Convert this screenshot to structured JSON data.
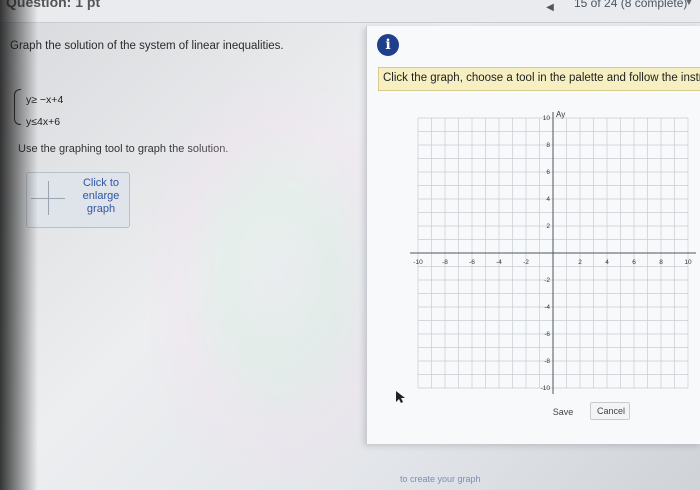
{
  "header": {
    "title": "Question: 1 pt",
    "progress": "15 of 24 (8 complete)",
    "prev_icon": "left-arrow-icon",
    "dropdown_icon": "chevron-down-icon"
  },
  "question": {
    "prompt": "Graph the solution of the system of linear inequalities.",
    "inequalities": [
      "y≥ −x+4",
      "y≤4x+6"
    ],
    "instruction": "Use the graphing tool to graph the solution.",
    "enlarge_label": "Click to enlarge graph"
  },
  "panel": {
    "info_icon": "i",
    "hint": "Click the graph, choose a tool in the palette and follow the instr",
    "graph": {
      "y_axis_label": "Ay",
      "x_ticks": [
        "-10",
        "-8",
        "-6",
        "-4",
        "-2",
        "2",
        "4",
        "6",
        "8",
        "10"
      ],
      "y_ticks_pos": [
        "10",
        "8",
        "6",
        "4",
        "2"
      ],
      "y_ticks_neg": [
        "-2",
        "-4",
        "-6",
        "-8",
        "-10"
      ],
      "x_range": [
        -10,
        10
      ],
      "y_range": [
        -10,
        10
      ]
    },
    "save_label": "Save",
    "cancel_label": "Cancel"
  },
  "footer": {
    "text": "to create your graph"
  },
  "colors": {
    "info_blue": "#1f3e8c",
    "hint_bg": "#f5efc2",
    "grid": "#c7cdd4",
    "axis": "#4b5563"
  }
}
